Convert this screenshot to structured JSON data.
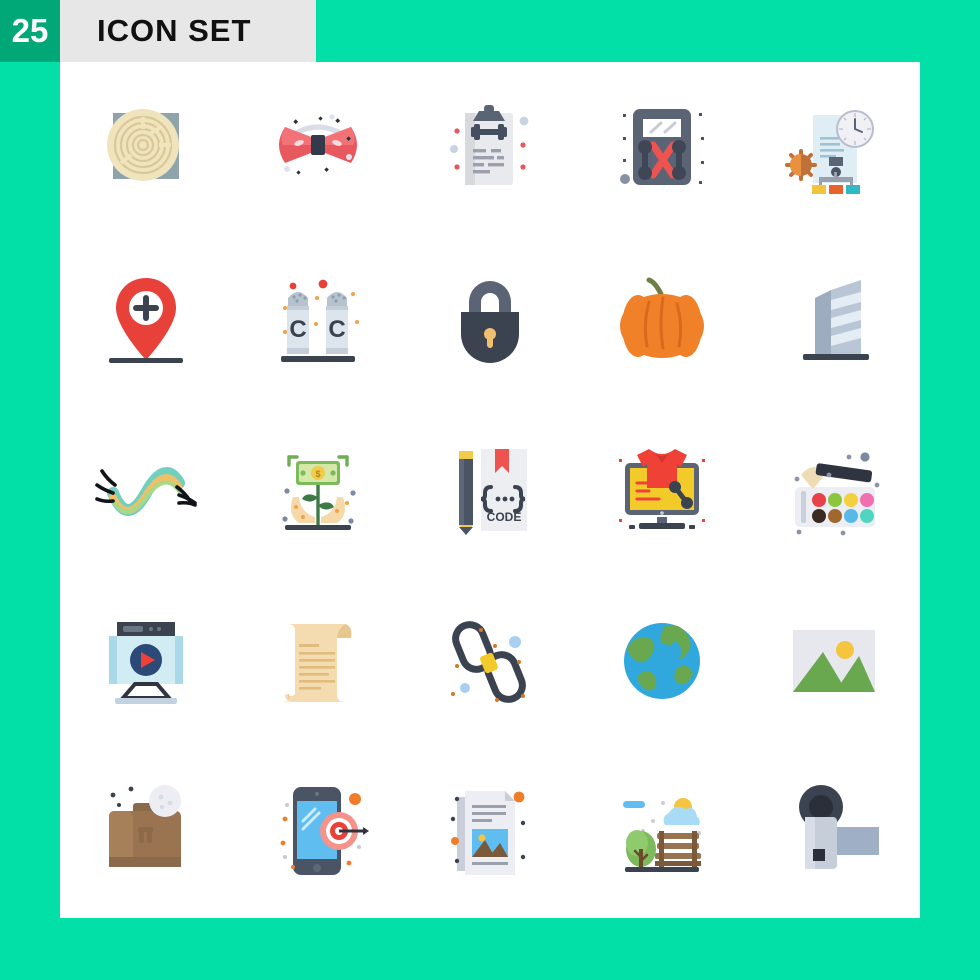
{
  "header": {
    "count": "25",
    "title": "ICON SET",
    "badge_color": "#00a878",
    "strip_color": "#e7e7e7",
    "background_color": "#02dfa7",
    "canvas_color": "#ffffff"
  },
  "grid": {
    "columns": 5,
    "rows": 5,
    "total": 25
  },
  "icons": [
    {
      "index": 1,
      "name": "maze-icon",
      "label": "Maze"
    },
    {
      "index": 2,
      "name": "bow-tie-icon",
      "label": "Bow"
    },
    {
      "index": 3,
      "name": "workout-clipboard-icon",
      "label": "Workout Plan"
    },
    {
      "index": 4,
      "name": "multimeter-icon",
      "label": "Tester"
    },
    {
      "index": 5,
      "name": "project-plan-icon",
      "label": "Project Plan"
    },
    {
      "index": 6,
      "name": "add-location-icon",
      "label": "Add Location"
    },
    {
      "index": 7,
      "name": "salt-pepper-icon",
      "label": "Salt and Pepper"
    },
    {
      "index": 8,
      "name": "padlock-icon",
      "label": "Lock"
    },
    {
      "index": 9,
      "name": "pumpkin-icon",
      "label": "Pumpkin"
    },
    {
      "index": 10,
      "name": "building-icon",
      "label": "Building"
    },
    {
      "index": 11,
      "name": "eyelashes-wave-icon",
      "label": "Lashes"
    },
    {
      "index": 12,
      "name": "money-plant-hands-icon",
      "label": "Investment"
    },
    {
      "index": 13,
      "name": "code-book-icon",
      "label": "Code"
    },
    {
      "index": 14,
      "name": "online-shopping-icon",
      "label": "Online Sale"
    },
    {
      "index": 15,
      "name": "paint-palette-icon",
      "label": "Paint Palette"
    },
    {
      "index": 16,
      "name": "video-player-icon",
      "label": "Video"
    },
    {
      "index": 17,
      "name": "scroll-icon",
      "label": "Scroll"
    },
    {
      "index": 18,
      "name": "chain-link-icon",
      "label": "Link"
    },
    {
      "index": 19,
      "name": "globe-icon",
      "label": "Globe"
    },
    {
      "index": 20,
      "name": "image-placeholder-icon",
      "label": "Image"
    },
    {
      "index": 21,
      "name": "briefcase-icon",
      "label": "Briefcase"
    },
    {
      "index": 22,
      "name": "mobile-target-icon",
      "label": "Mobile Marketing"
    },
    {
      "index": 23,
      "name": "newspaper-icon",
      "label": "Article"
    },
    {
      "index": 24,
      "name": "park-bench-icon",
      "label": "Park"
    },
    {
      "index": 25,
      "name": "camcorder-icon",
      "label": "Video Camera"
    }
  ],
  "icon_text": {
    "code_label": "CODE",
    "shaker_letter_left": "C",
    "shaker_letter_right": "C"
  },
  "palette_colors": [
    "#e8414a",
    "#8cc63f",
    "#f5cf3c",
    "#f06fae",
    "#3b2a21",
    "#a0682f",
    "#57b9e8",
    "#4fd6c0"
  ]
}
